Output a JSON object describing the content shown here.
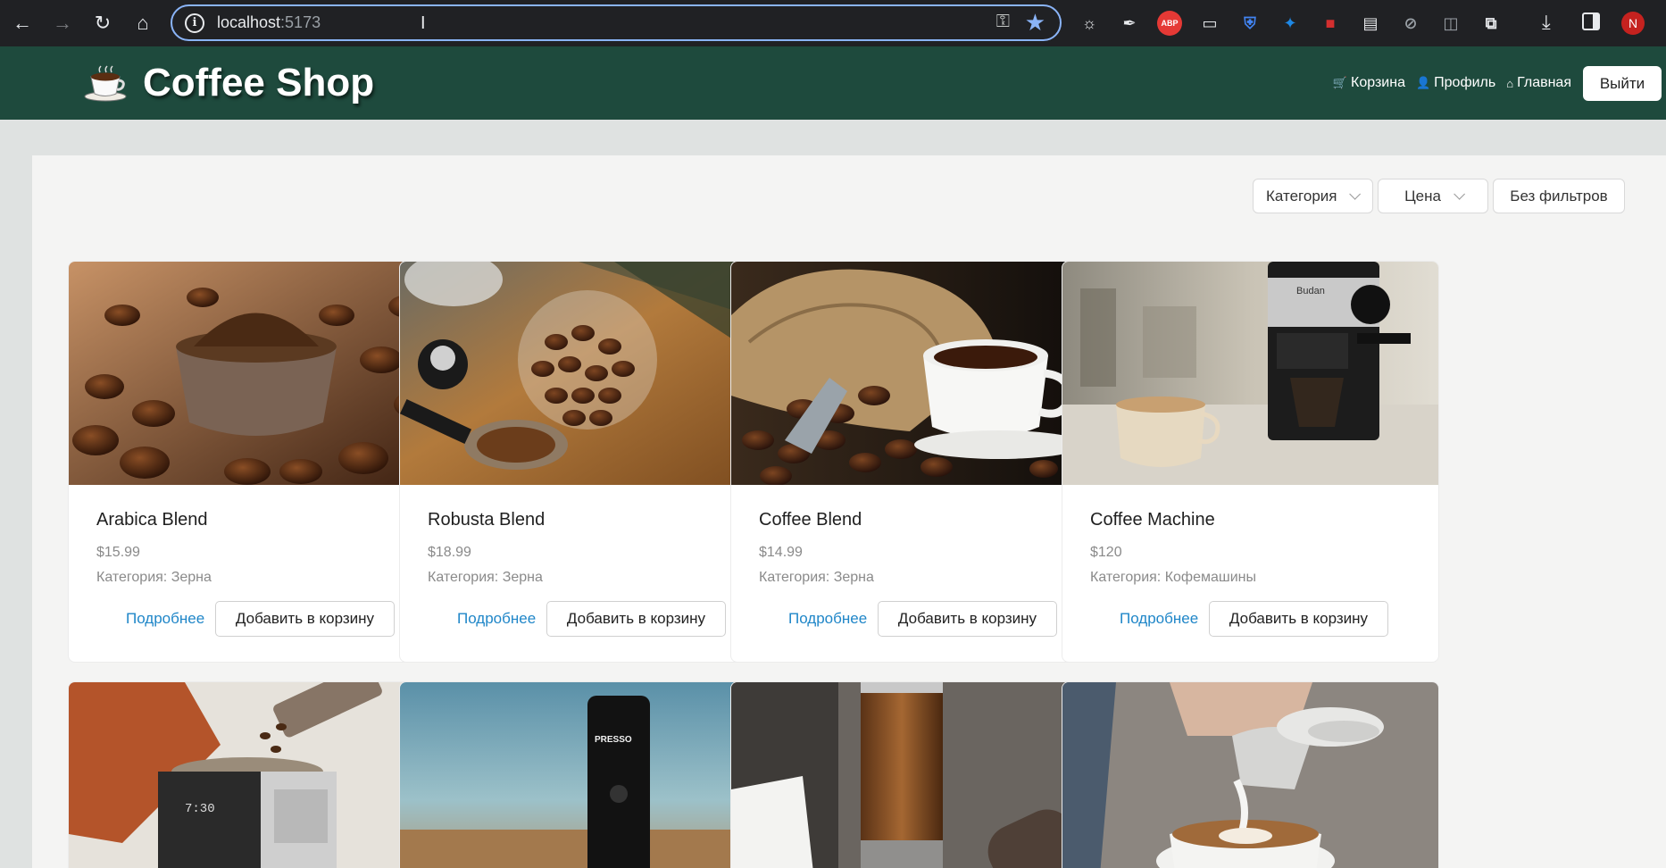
{
  "browser": {
    "url_host": "localhost",
    "url_port": ":5173",
    "avatar_letter": "N",
    "extensions": [
      {
        "icon": "sun-extension-icon",
        "glyph": "☼",
        "color": "#e8eaed"
      },
      {
        "icon": "pen-extension-icon",
        "glyph": "✒",
        "color": "#e8eaed"
      },
      {
        "icon": "adblock-extension-icon",
        "glyph": "ABP",
        "color": "#e53935"
      },
      {
        "icon": "clipboard-extension-icon",
        "glyph": "▭",
        "color": "#e8eaed"
      },
      {
        "icon": "shield-extension-icon",
        "glyph": "⛨",
        "color": "#4285f4"
      },
      {
        "icon": "bird-extension-icon",
        "glyph": "✦",
        "color": "#1e88e5"
      },
      {
        "icon": "record-extension-icon",
        "glyph": "■",
        "color": "#d32f2f"
      },
      {
        "icon": "layout-extension-icon",
        "glyph": "▤",
        "color": "#e8eaed"
      },
      {
        "icon": "compass-extension-icon",
        "glyph": "⊘",
        "color": "#9aa0a6"
      },
      {
        "icon": "block-extension-icon",
        "glyph": "◫",
        "color": "#9aa0a6"
      },
      {
        "icon": "puzzle-extension-icon",
        "glyph": "⧉",
        "color": "#e8eaed"
      }
    ]
  },
  "header": {
    "brand": "Coffee Shop",
    "links": [
      {
        "icon": "cart-icon",
        "glyph": "🛒",
        "label": "Корзина"
      },
      {
        "icon": "user-icon",
        "glyph": "👤",
        "label": "Профиль"
      },
      {
        "icon": "home-icon",
        "glyph": "⌂",
        "label": "Главная"
      }
    ],
    "logout": "Выйти"
  },
  "filters": {
    "category": "Категория",
    "price": "Цена",
    "reset": "Без фильтров"
  },
  "products": [
    {
      "name": "Arabica Blend",
      "price": "$15.99",
      "category": "Категория: Зерна",
      "more": "Подробнее",
      "add": "Добавить в корзину"
    },
    {
      "name": "Robusta Blend",
      "price": "$18.99",
      "category": "Категория: Зерна",
      "more": "Подробнее",
      "add": "Добавить в корзину"
    },
    {
      "name": "Coffee Blend",
      "price": "$14.99",
      "category": "Категория: Зерна",
      "more": "Подробнее",
      "add": "Добавить в корзину"
    },
    {
      "name": "Coffee Machine",
      "price": "$120",
      "category": "Категория: Кофемашины",
      "more": "Подробнее",
      "add": "Добавить в корзину"
    }
  ],
  "image_text": {
    "machine_brand": "Budan",
    "grinder_brand": "PRESSO",
    "machine_display": "7:30"
  }
}
